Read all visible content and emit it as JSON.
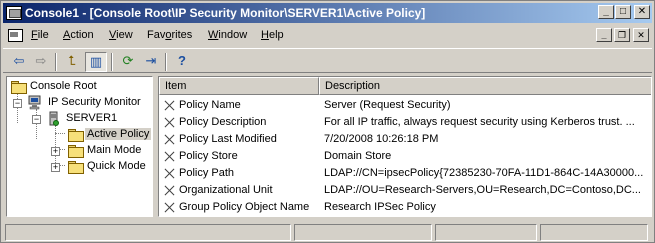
{
  "window": {
    "title": "Console1 - [Console Root\\IP Security Monitor\\SERVER1\\Active Policy]",
    "controls": {
      "minimize": "_",
      "maximize": "□",
      "close": "✕"
    }
  },
  "menubar": {
    "items": [
      {
        "label": "File",
        "accel": "F",
        "rest": "ile"
      },
      {
        "label": "Action",
        "accel": "A",
        "rest": "ction"
      },
      {
        "label": "View",
        "accel": "V",
        "rest": "iew"
      },
      {
        "label": "Favorites",
        "accel": "o",
        "pre": "Fav",
        "rest": "rites"
      },
      {
        "label": "Window",
        "accel": "W",
        "rest": "indow"
      },
      {
        "label": "Help",
        "accel": "H",
        "rest": "elp"
      }
    ],
    "child_controls": {
      "minimize": "_",
      "restore": "❐",
      "close": "✕"
    }
  },
  "toolbar": {
    "buttons": [
      {
        "name": "back-button",
        "glyph": "⇦"
      },
      {
        "name": "forward-button",
        "glyph": "⇨"
      },
      {
        "name": "up-one-level-button",
        "glyph": "⮤"
      },
      {
        "name": "show-hide-tree-button",
        "glyph": "▥"
      },
      {
        "name": "refresh-button",
        "glyph": "⟳"
      },
      {
        "name": "export-list-button",
        "glyph": "⇥"
      },
      {
        "name": "help-button",
        "glyph": "?"
      }
    ]
  },
  "tree": {
    "nodes": [
      {
        "label": "Console Root",
        "icon": "folder-icon"
      },
      {
        "label": "IP Security Monitor",
        "icon": "ip-security-monitor-icon",
        "expander": "−"
      },
      {
        "label": "SERVER1",
        "icon": "server-icon",
        "expander": "−"
      },
      {
        "label": "Active Policy",
        "icon": "folder-icon",
        "selected": true
      },
      {
        "label": "Main Mode",
        "icon": "folder-icon",
        "expander": "+"
      },
      {
        "label": "Quick Mode",
        "icon": "folder-icon",
        "expander": "+"
      }
    ]
  },
  "list": {
    "columns": [
      "Item",
      "Description"
    ],
    "rows": [
      {
        "item": "Policy Name",
        "description": "Server (Request Security)"
      },
      {
        "item": "Policy Description",
        "description": "For all IP traffic, always request security using Kerberos trust. ..."
      },
      {
        "item": "Policy Last Modified",
        "description": "7/20/2008 10:26:18 PM"
      },
      {
        "item": "Policy Store",
        "description": "Domain Store"
      },
      {
        "item": "Policy Path",
        "description": "LDAP://CN=ipsecPolicy{72385230-70FA-11D1-864C-14A30000..."
      },
      {
        "item": "Organizational Unit",
        "description": "LDAP://OU=Research-Servers,OU=Research,DC=Contoso,DC..."
      },
      {
        "item": "Group Policy Object Name",
        "description": "Research IPSec Policy"
      }
    ]
  },
  "statusbar": {
    "panels": [
      "",
      "",
      "",
      ""
    ]
  }
}
